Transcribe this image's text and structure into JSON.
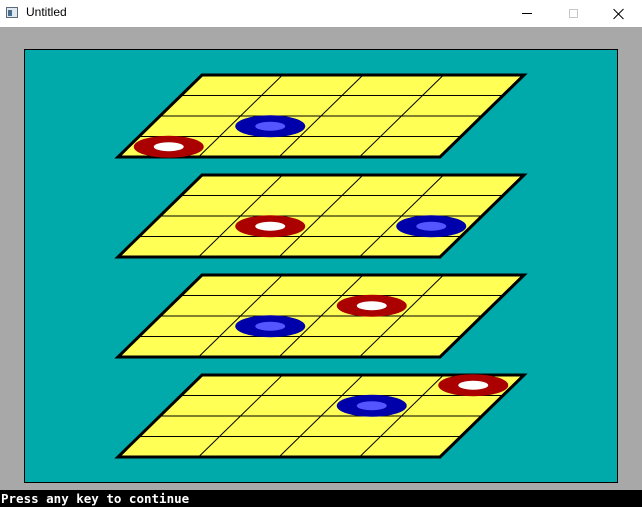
{
  "window": {
    "title": "Untitled",
    "icon": "app-window-icon",
    "controls": [
      "minimize-icon",
      "maximize-icon",
      "close-icon"
    ]
  },
  "colors": {
    "frame": "#a8a8a8",
    "background": "#00aaaa",
    "board": "#ffff55",
    "grid": "#000000",
    "red_piece": "#aa0000",
    "blue_piece": "#0000aa",
    "blue_piece_inner": "#5555ff",
    "red_piece_inner": "#ffffff"
  },
  "game": {
    "boards": [
      {
        "level": 1,
        "pieces": [
          {
            "color": "blue",
            "row": 2,
            "col": 1
          },
          {
            "color": "red",
            "row": 3,
            "col": 0
          }
        ]
      },
      {
        "level": 2,
        "pieces": [
          {
            "color": "red",
            "row": 2,
            "col": 1
          },
          {
            "color": "blue",
            "row": 2,
            "col": 3
          }
        ]
      },
      {
        "level": 3,
        "pieces": [
          {
            "color": "red",
            "row": 1,
            "col": 2
          },
          {
            "color": "blue",
            "row": 2,
            "col": 1
          }
        ]
      },
      {
        "level": 4,
        "pieces": [
          {
            "color": "red",
            "row": 0,
            "col": 3
          },
          {
            "color": "blue",
            "row": 1,
            "col": 2
          }
        ]
      }
    ]
  },
  "status": {
    "message": "Press any key to continue"
  }
}
